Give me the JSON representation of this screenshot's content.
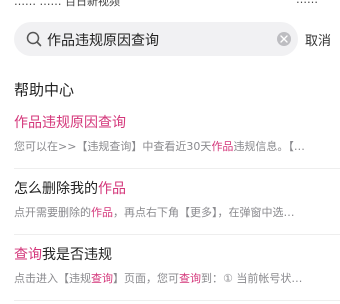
{
  "status_bar": {
    "left_text": "…… …… 百日新视频",
    "right_text": "……"
  },
  "search": {
    "query": "作品违规原因查询",
    "cancel_label": "取消"
  },
  "section": {
    "title": "帮助中心"
  },
  "results": [
    {
      "title_parts": [
        {
          "text": "作品违规原因查询",
          "highlight": true
        }
      ],
      "snippet_parts": [
        {
          "text": "您可以在>>【违规查询】中查看近30天",
          "highlight": false
        },
        {
          "text": "作品",
          "highlight": true
        },
        {
          "text": "违规信息。【…",
          "highlight": false
        }
      ]
    },
    {
      "title_parts": [
        {
          "text": "怎么删除我的",
          "highlight": false
        },
        {
          "text": "作品",
          "highlight": true
        }
      ],
      "snippet_parts": [
        {
          "text": "点开需要删除的",
          "highlight": false
        },
        {
          "text": "作品",
          "highlight": true
        },
        {
          "text": "，再点右下角【更多】，在弹窗中选…",
          "highlight": false
        }
      ]
    },
    {
      "title_parts": [
        {
          "text": "查询",
          "highlight": true
        },
        {
          "text": "我是否违规",
          "highlight": false
        }
      ],
      "snippet_parts": [
        {
          "text": "点击进入【违规",
          "highlight": false
        },
        {
          "text": "查询",
          "highlight": true
        },
        {
          "text": "】页面，您可",
          "highlight": false
        },
        {
          "text": "查询",
          "highlight": true
        },
        {
          "text": "到：① 当前帐号状…",
          "highlight": false
        }
      ]
    }
  ],
  "colors": {
    "highlight": "#d4367a",
    "search_bg": "#f1f1f3",
    "snippet": "#8a8a8e"
  },
  "icons": {
    "search": "search-icon",
    "clear": "clear-icon"
  }
}
